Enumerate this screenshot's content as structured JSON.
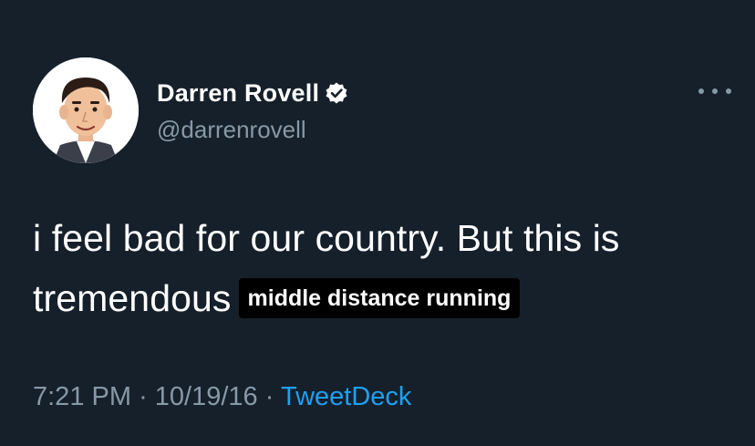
{
  "user": {
    "display_name": "Darren Rovell",
    "handle": "@darrenrovell",
    "verified": true,
    "avatar_icon": "cartoon-avatar"
  },
  "tweet": {
    "text": "i feel bad for our country. But this is tremendous",
    "overlay_label": "middle distance running",
    "time": "7:21 PM",
    "separator": "·",
    "date": "10/19/16",
    "source": "TweetDeck"
  },
  "colors": {
    "background": "#15202b",
    "text": "#ffffff",
    "muted": "#8899a6",
    "link": "#1da1f2",
    "label_bg": "#000000"
  },
  "icons": {
    "verified": "verified-badge-icon",
    "more": "more-options-icon"
  }
}
